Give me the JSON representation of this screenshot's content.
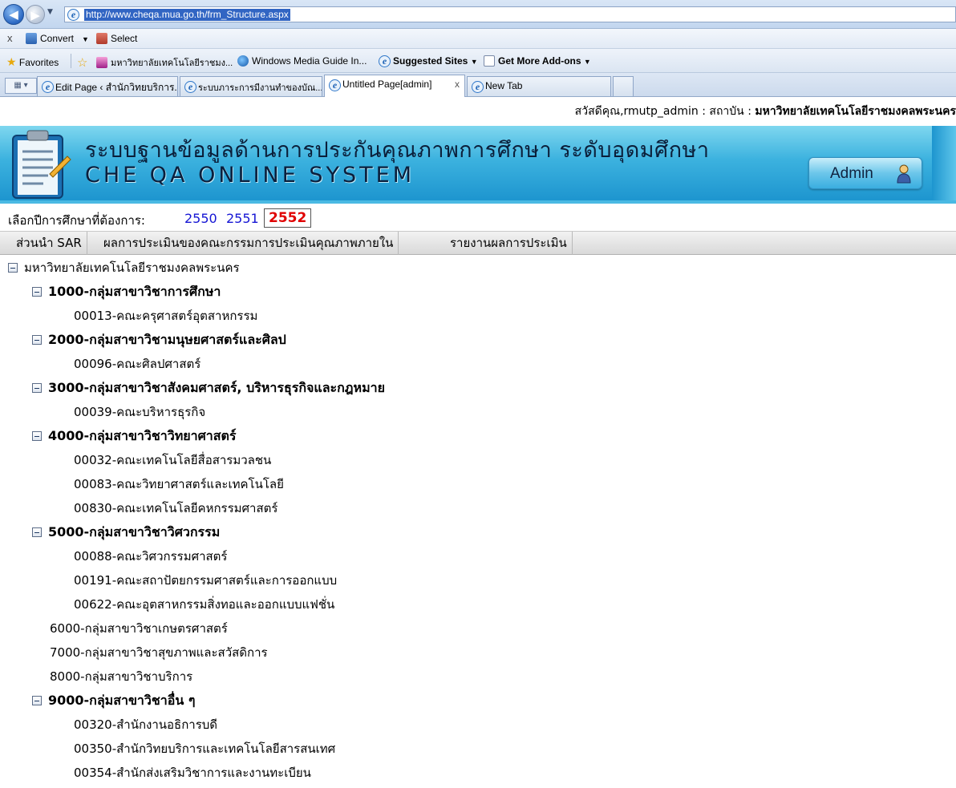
{
  "browser": {
    "url": "http://www.cheqa.mua.go.th/frm_Structure.aspx",
    "commandbar": {
      "close": "x",
      "convert_label": "Convert",
      "select_label": "Select"
    },
    "favorites_bar": {
      "favorites_label": "Favorites",
      "items": [
        "มหาวิทยาลัยเทคโนโลยีราชมง...",
        "Windows Media Guide In...",
        "Suggested Sites",
        "Get More Add-ons"
      ]
    },
    "tabs": [
      {
        "label": "Edit Page ‹ สำนักวิทยบริการ..."
      },
      {
        "label": "ระบบภาระการมีงานทำของบัณ..."
      },
      {
        "label": "Untitled Page[admin]",
        "close": "x"
      },
      {
        "label": "New Tab"
      }
    ]
  },
  "page": {
    "greeting": "สวัสดีคุณ,rmutp_admin : สถาบัน : ",
    "institution": "มหาวิทยาลัยเทคโนโลยีราชมงคลพระนคร",
    "banner": {
      "title_th": "ระบบฐานข้อมูลด้านการประกันคุณภาพการศึกษา ระดับอุดมศึกษา",
      "title_en": "CHE QA ONLINE SYSTEM",
      "admin_label": "Admin"
    },
    "year_select": {
      "label": "เลือกปีการศึกษาที่ต้องการ:",
      "years": [
        "2550",
        "2551",
        "2552"
      ],
      "selected": "2552"
    },
    "menu": [
      "ส่วนนำ SAR",
      "ผลการประเมินของคณะกรรมการประเมินคุณภาพภายใน",
      "รายงานผลการประเมิน"
    ],
    "tree": {
      "root": "มหาวิทยาลัยเทคโนโลยีราชมงคลพระนคร",
      "groups": [
        {
          "label": "1000-กลุ่มสาขาวิชาการศึกษา",
          "children": [
            "00013-คณะครุศาสตร์อุตสาหกรรม"
          ]
        },
        {
          "label": "2000-กลุ่มสาขาวิชามนุษยศาสตร์และศิลป",
          "children": [
            "00096-คณะศิลปศาสตร์"
          ]
        },
        {
          "label": "3000-กลุ่มสาขาวิชาสังคมศาสตร์, บริหารธุรกิจและกฎหมาย",
          "children": [
            "00039-คณะบริหารธุรกิจ"
          ]
        },
        {
          "label": "4000-กลุ่มสาขาวิชาวิทยาศาสตร์",
          "children": [
            "00032-คณะเทคโนโลยีสื่อสารมวลชน",
            "00083-คณะวิทยาศาสตร์และเทคโนโลยี",
            "00830-คณะเทคโนโลยีคหกรรมศาสตร์"
          ]
        },
        {
          "label": "5000-กลุ่มสาขาวิชาวิศวกรรม",
          "children": [
            "00088-คณะวิศวกรรมศาสตร์",
            "00191-คณะสถาปัตยกรรมศาสตร์และการออกแบบ",
            "00622-คณะอุตสาหกรรมสิ่งทอและออกแบบแฟชั่น"
          ]
        },
        {
          "label": "6000-กลุ่มสาขาวิชาเกษตรศาสตร์",
          "children": []
        },
        {
          "label": "7000-กลุ่มสาขาวิชาสุขภาพและสวัสดิการ",
          "children": []
        },
        {
          "label": "8000-กลุ่มสาขาวิชาบริการ",
          "children": []
        },
        {
          "label": "9000-กลุ่มสาขาวิชาอื่น ๆ",
          "children": [
            "00320-สำนักงานอธิการบดี",
            "00350-สำนักวิทยบริการและเทคโนโลยีสารสนเทศ",
            "00354-สำนักส่งเสริมวิชาการและงานทะเบียน"
          ]
        }
      ]
    }
  }
}
